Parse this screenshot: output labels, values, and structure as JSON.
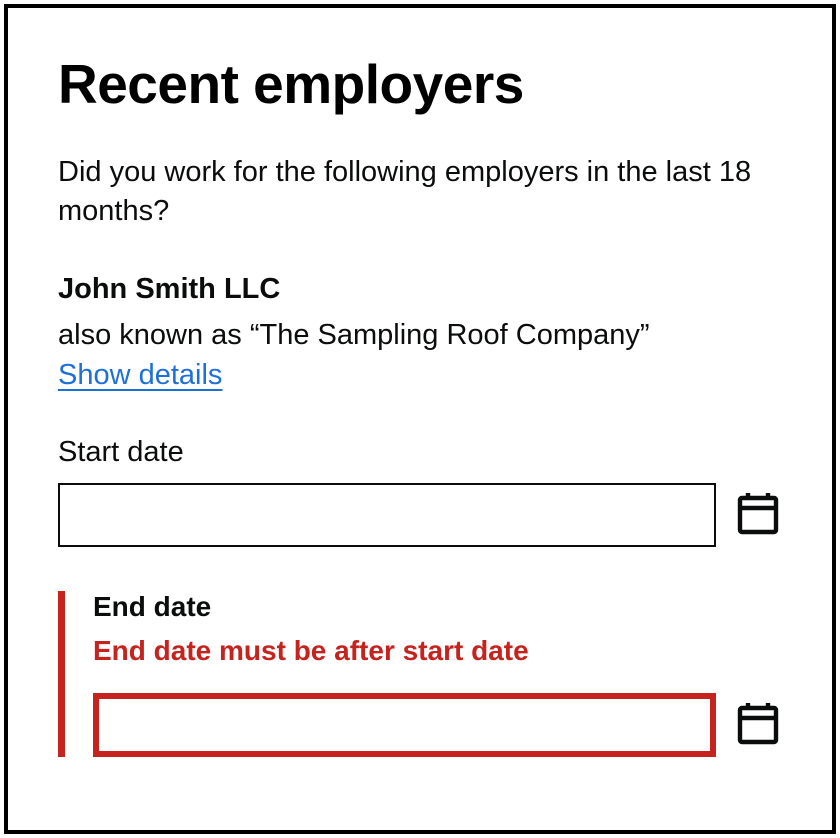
{
  "heading": "Recent employers",
  "intro": "Did you work for the following employers in the last 18 months?",
  "employer": {
    "name": "John Smith LLC",
    "aka": "also known as “The Sampling Roof Company”",
    "show_details": "Show details"
  },
  "start_date": {
    "label": "Start date",
    "value": ""
  },
  "end_date": {
    "label": "End date",
    "value": "",
    "error": "End date must be after start date"
  }
}
